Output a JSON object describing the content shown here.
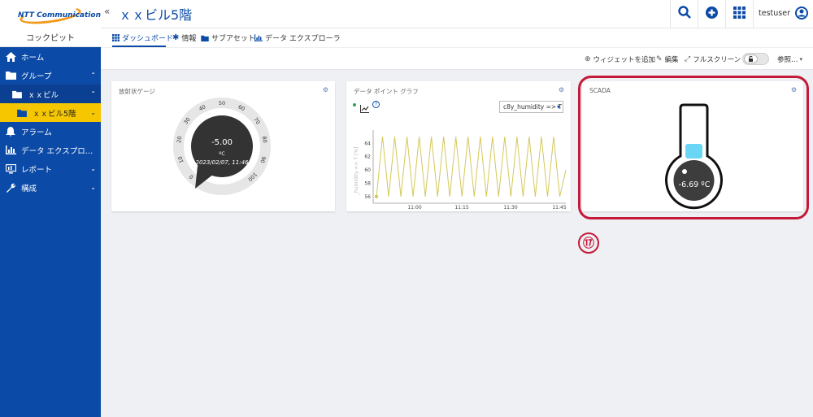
{
  "brand": {
    "logo_text": "NTT Communications",
    "sub": "コックピット"
  },
  "topbar": {
    "title": "ｘｘビル5階",
    "user": "testuser"
  },
  "sidebar": {
    "items": [
      {
        "label": "ホーム",
        "icon": "home-icon"
      },
      {
        "label": "グループ",
        "icon": "folder-icon",
        "chevron": "⌃"
      },
      {
        "label": "ｘｘビル",
        "icon": "folder-icon",
        "chevron": "⌃"
      },
      {
        "label": "ｘｘビル5階",
        "icon": "folder-icon",
        "chevron": "⌄"
      },
      {
        "label": "アラーム",
        "icon": "bell-icon"
      },
      {
        "label": "データ エクスプロ…",
        "icon": "chart-icon"
      },
      {
        "label": "レポート",
        "icon": "report-icon",
        "chevron": "⌄"
      },
      {
        "label": "構成",
        "icon": "wrench-icon",
        "chevron": "⌄"
      }
    ]
  },
  "tabs": [
    {
      "label": "ダッシュボード",
      "icon": "grid-icon"
    },
    {
      "label": "情報",
      "icon": "asterisk-icon"
    },
    {
      "label": "サブアセット",
      "icon": "folder-icon"
    },
    {
      "label": "データ エクスプローラ",
      "icon": "chart-icon"
    }
  ],
  "actions": {
    "add_widget": "ウィジェットを追加",
    "edit": "編集",
    "fullscreen": "フルスクリーン",
    "more": "参照…"
  },
  "widgets": {
    "gauge": {
      "title": "放射状ゲージ",
      "value": "-5.00",
      "unit": "ºC",
      "timestamp": "2023/02/07, 11:46",
      "ticks": [
        "0",
        "10",
        "20",
        "30",
        "40",
        "50",
        "60",
        "70",
        "80",
        "90",
        "100"
      ]
    },
    "graph": {
      "title": "データ ポイント グラフ",
      "selector": "c8y_humidity => T",
      "ylabel": "_humidity => T [%]"
    },
    "scada": {
      "title": "SCADA",
      "value": "-6.69 ºC"
    }
  },
  "callout": {
    "label": "⑰"
  },
  "chart_data": {
    "type": "line",
    "ylabel": "_humidity => T [%]",
    "x_ticks": [
      "11:00",
      "11:15",
      "11:30",
      "11:45"
    ],
    "y_ticks": [
      "56",
      "58",
      "60",
      "62",
      "64"
    ],
    "ylim": [
      55,
      66
    ],
    "series": [
      {
        "color": "#d4c85a",
        "values": [
          56,
          65,
          56,
          65,
          56,
          65,
          56,
          65,
          56,
          65,
          56,
          65,
          56,
          65,
          56,
          65,
          56,
          65,
          56,
          65,
          56,
          65,
          56,
          65,
          56,
          65,
          56,
          65,
          56,
          65,
          56,
          60
        ]
      }
    ]
  }
}
